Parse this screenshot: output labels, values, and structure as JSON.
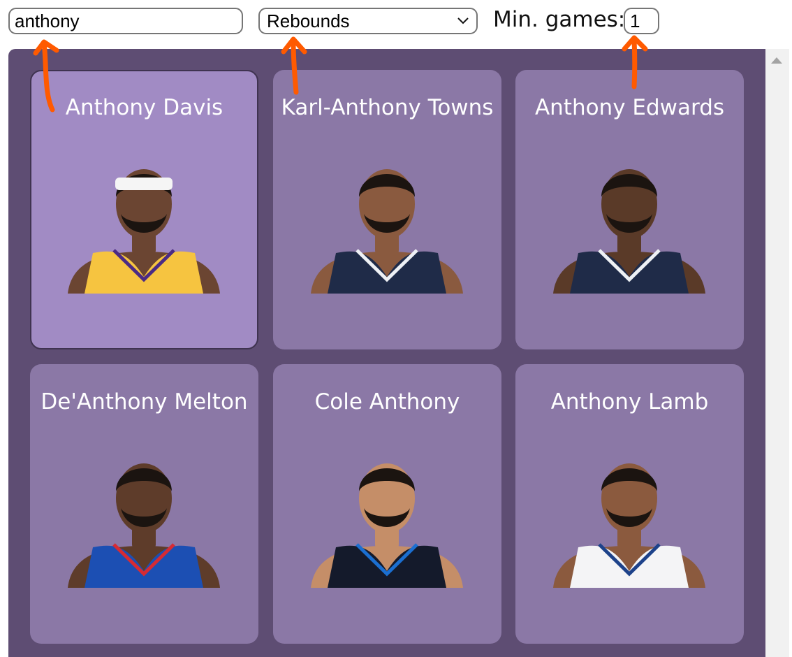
{
  "search": {
    "value": "anthony"
  },
  "stat_select": {
    "selected": "Rebounds"
  },
  "min_games": {
    "label": "Min. games:",
    "value": "1"
  },
  "colors": {
    "panel": "#5e4d73",
    "card": "#8b78a6",
    "card_selected": "#a18bc4",
    "annotation_arrow": "#ff5a00"
  },
  "players": [
    {
      "name": "Anthony Davis",
      "selected": true,
      "jersey": "#f6c440",
      "jersey_trim": "#4b2b84",
      "skin": "#6b4532",
      "headband": true
    },
    {
      "name": "Karl-Anthony Towns",
      "selected": false,
      "jersey": "#1f2b48",
      "jersey_trim": "#eef1f5",
      "skin": "#8a5a3f"
    },
    {
      "name": "Anthony Edwards",
      "selected": false,
      "jersey": "#1f2b48",
      "jersey_trim": "#eef1f5",
      "skin": "#5a3a28"
    },
    {
      "name": "De'Anthony Melton",
      "selected": false,
      "jersey": "#1c4fb3",
      "jersey_trim": "#d62b34",
      "skin": "#5e3c2a"
    },
    {
      "name": "Cole Anthony",
      "selected": false,
      "jersey": "#141a2b",
      "jersey_trim": "#1b6fd1",
      "skin": "#c58e68"
    },
    {
      "name": "Anthony Lamb",
      "selected": false,
      "jersey": "#f4f4f6",
      "jersey_trim": "#1d428a",
      "skin": "#8b5a3e"
    }
  ]
}
